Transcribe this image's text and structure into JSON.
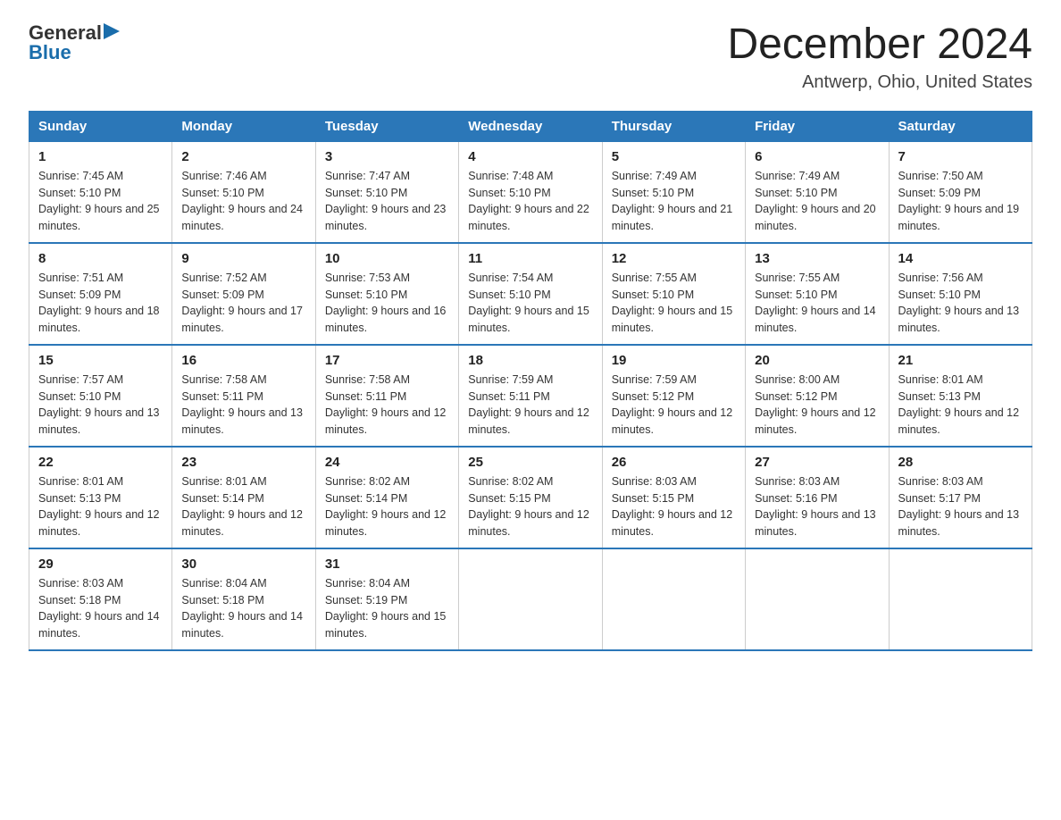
{
  "header": {
    "logo_general": "General",
    "logo_blue": "Blue",
    "month_title": "December 2024",
    "location": "Antwerp, Ohio, United States"
  },
  "days_of_week": [
    "Sunday",
    "Monday",
    "Tuesday",
    "Wednesday",
    "Thursday",
    "Friday",
    "Saturday"
  ],
  "weeks": [
    [
      {
        "day": "1",
        "sunrise": "7:45 AM",
        "sunset": "5:10 PM",
        "daylight": "9 hours and 25 minutes."
      },
      {
        "day": "2",
        "sunrise": "7:46 AM",
        "sunset": "5:10 PM",
        "daylight": "9 hours and 24 minutes."
      },
      {
        "day": "3",
        "sunrise": "7:47 AM",
        "sunset": "5:10 PM",
        "daylight": "9 hours and 23 minutes."
      },
      {
        "day": "4",
        "sunrise": "7:48 AM",
        "sunset": "5:10 PM",
        "daylight": "9 hours and 22 minutes."
      },
      {
        "day": "5",
        "sunrise": "7:49 AM",
        "sunset": "5:10 PM",
        "daylight": "9 hours and 21 minutes."
      },
      {
        "day": "6",
        "sunrise": "7:49 AM",
        "sunset": "5:10 PM",
        "daylight": "9 hours and 20 minutes."
      },
      {
        "day": "7",
        "sunrise": "7:50 AM",
        "sunset": "5:09 PM",
        "daylight": "9 hours and 19 minutes."
      }
    ],
    [
      {
        "day": "8",
        "sunrise": "7:51 AM",
        "sunset": "5:09 PM",
        "daylight": "9 hours and 18 minutes."
      },
      {
        "day": "9",
        "sunrise": "7:52 AM",
        "sunset": "5:09 PM",
        "daylight": "9 hours and 17 minutes."
      },
      {
        "day": "10",
        "sunrise": "7:53 AM",
        "sunset": "5:10 PM",
        "daylight": "9 hours and 16 minutes."
      },
      {
        "day": "11",
        "sunrise": "7:54 AM",
        "sunset": "5:10 PM",
        "daylight": "9 hours and 15 minutes."
      },
      {
        "day": "12",
        "sunrise": "7:55 AM",
        "sunset": "5:10 PM",
        "daylight": "9 hours and 15 minutes."
      },
      {
        "day": "13",
        "sunrise": "7:55 AM",
        "sunset": "5:10 PM",
        "daylight": "9 hours and 14 minutes."
      },
      {
        "day": "14",
        "sunrise": "7:56 AM",
        "sunset": "5:10 PM",
        "daylight": "9 hours and 13 minutes."
      }
    ],
    [
      {
        "day": "15",
        "sunrise": "7:57 AM",
        "sunset": "5:10 PM",
        "daylight": "9 hours and 13 minutes."
      },
      {
        "day": "16",
        "sunrise": "7:58 AM",
        "sunset": "5:11 PM",
        "daylight": "9 hours and 13 minutes."
      },
      {
        "day": "17",
        "sunrise": "7:58 AM",
        "sunset": "5:11 PM",
        "daylight": "9 hours and 12 minutes."
      },
      {
        "day": "18",
        "sunrise": "7:59 AM",
        "sunset": "5:11 PM",
        "daylight": "9 hours and 12 minutes."
      },
      {
        "day": "19",
        "sunrise": "7:59 AM",
        "sunset": "5:12 PM",
        "daylight": "9 hours and 12 minutes."
      },
      {
        "day": "20",
        "sunrise": "8:00 AM",
        "sunset": "5:12 PM",
        "daylight": "9 hours and 12 minutes."
      },
      {
        "day": "21",
        "sunrise": "8:01 AM",
        "sunset": "5:13 PM",
        "daylight": "9 hours and 12 minutes."
      }
    ],
    [
      {
        "day": "22",
        "sunrise": "8:01 AM",
        "sunset": "5:13 PM",
        "daylight": "9 hours and 12 minutes."
      },
      {
        "day": "23",
        "sunrise": "8:01 AM",
        "sunset": "5:14 PM",
        "daylight": "9 hours and 12 minutes."
      },
      {
        "day": "24",
        "sunrise": "8:02 AM",
        "sunset": "5:14 PM",
        "daylight": "9 hours and 12 minutes."
      },
      {
        "day": "25",
        "sunrise": "8:02 AM",
        "sunset": "5:15 PM",
        "daylight": "9 hours and 12 minutes."
      },
      {
        "day": "26",
        "sunrise": "8:03 AM",
        "sunset": "5:15 PM",
        "daylight": "9 hours and 12 minutes."
      },
      {
        "day": "27",
        "sunrise": "8:03 AM",
        "sunset": "5:16 PM",
        "daylight": "9 hours and 13 minutes."
      },
      {
        "day": "28",
        "sunrise": "8:03 AM",
        "sunset": "5:17 PM",
        "daylight": "9 hours and 13 minutes."
      }
    ],
    [
      {
        "day": "29",
        "sunrise": "8:03 AM",
        "sunset": "5:18 PM",
        "daylight": "9 hours and 14 minutes."
      },
      {
        "day": "30",
        "sunrise": "8:04 AM",
        "sunset": "5:18 PM",
        "daylight": "9 hours and 14 minutes."
      },
      {
        "day": "31",
        "sunrise": "8:04 AM",
        "sunset": "5:19 PM",
        "daylight": "9 hours and 15 minutes."
      },
      null,
      null,
      null,
      null
    ]
  ]
}
